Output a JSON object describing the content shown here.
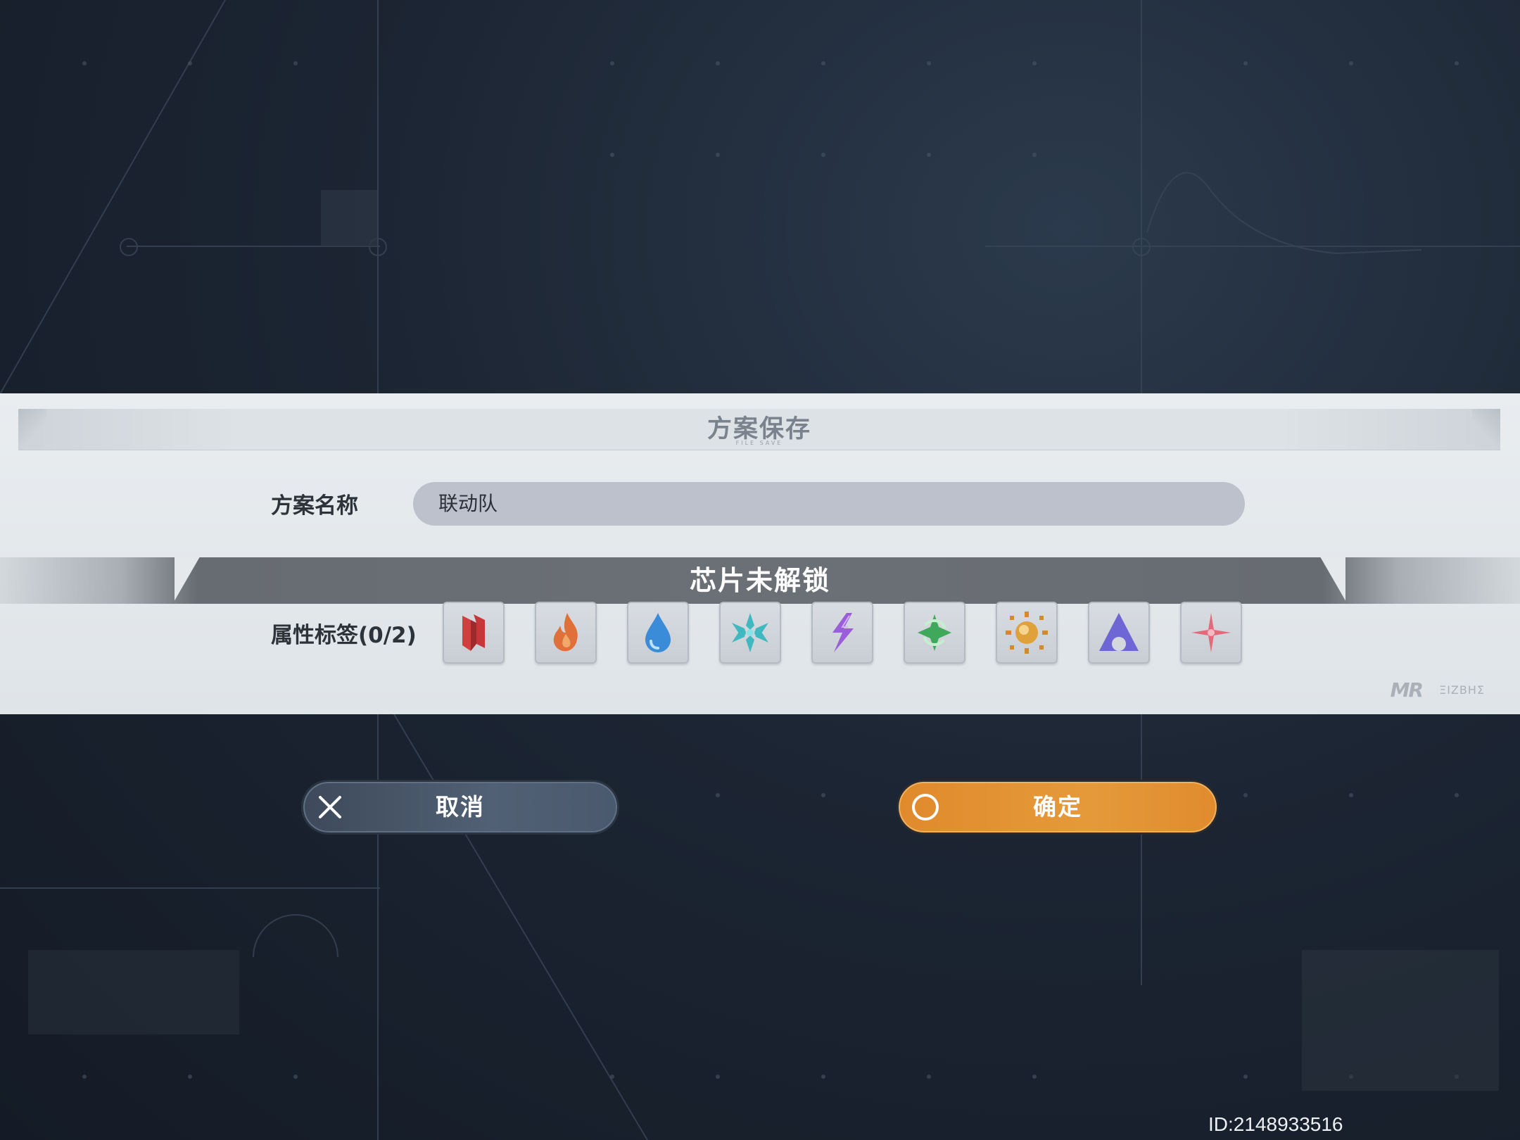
{
  "dialog": {
    "title": "方案保存",
    "title_sub": "FILE SAVE",
    "name_label": "方案名称",
    "name_value": "联动队",
    "lock_text": "芯片未解锁",
    "attr_label": "属性标签(0/2)",
    "attributes": [
      {
        "icon": "physical-icon",
        "color": "#d0403f"
      },
      {
        "icon": "fire-icon",
        "color": "#e0703a"
      },
      {
        "icon": "water-icon",
        "color": "#3a8bd8"
      },
      {
        "icon": "ice-icon",
        "color": "#3fb8c0"
      },
      {
        "icon": "electric-icon",
        "color": "#9a5fd8"
      },
      {
        "icon": "wind-icon",
        "color": "#3fa85a"
      },
      {
        "icon": "light-icon",
        "color": "#e0a03a"
      },
      {
        "icon": "dark-icon",
        "color": "#6f66d6"
      },
      {
        "icon": "star-icon",
        "color": "#e36a7a"
      }
    ],
    "logo_mr": "MR",
    "logo_2": "ΞIZBHΣ"
  },
  "buttons": {
    "cancel_label": "取消",
    "confirm_label": "确定"
  },
  "footer": {
    "uid": "ID:2148933516"
  },
  "colors": {
    "accent_orange": "#e59a3a",
    "cancel_blue": "#516074"
  }
}
